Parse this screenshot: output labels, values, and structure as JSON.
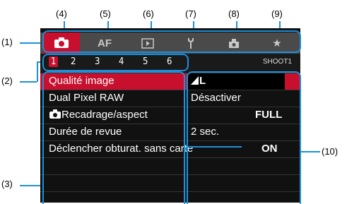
{
  "callouts": {
    "c1": "(1)",
    "c2": "(2)",
    "c3": "(3)",
    "c4": "(4)",
    "c5": "(5)",
    "c6": "(6)",
    "c7": "(7)",
    "c8": "(8)",
    "c9": "(9)",
    "c10": "(10)"
  },
  "tabs": [
    {
      "icon": "camera-icon",
      "label": "",
      "active": true
    },
    {
      "icon": "af-icon",
      "label": "AF",
      "active": false
    },
    {
      "icon": "playback-icon",
      "label": "▶",
      "active": false
    },
    {
      "icon": "wrench-icon",
      "label": "",
      "active": false
    },
    {
      "icon": "custom-icon",
      "label": "",
      "active": false
    },
    {
      "icon": "star-icon",
      "label": "★",
      "active": false
    }
  ],
  "pages": [
    "1",
    "2",
    "3",
    "4",
    "5",
    "6"
  ],
  "page_id": "SHOOT1",
  "menu": [
    {
      "label": "Qualité image",
      "value": "L",
      "selected": true
    },
    {
      "label": "Dual Pixel RAW",
      "value": "Désactiver",
      "selected": false
    },
    {
      "label": "Recadrage/aspect",
      "value": "FULL",
      "selected": false
    },
    {
      "label": "Durée de revue",
      "value": "2 sec.",
      "selected": false
    },
    {
      "label": "Déclencher obturat. sans carte",
      "value": "ON",
      "selected": false
    }
  ],
  "colors": {
    "accent": "#c8102e",
    "callout": "#1e90d8"
  }
}
